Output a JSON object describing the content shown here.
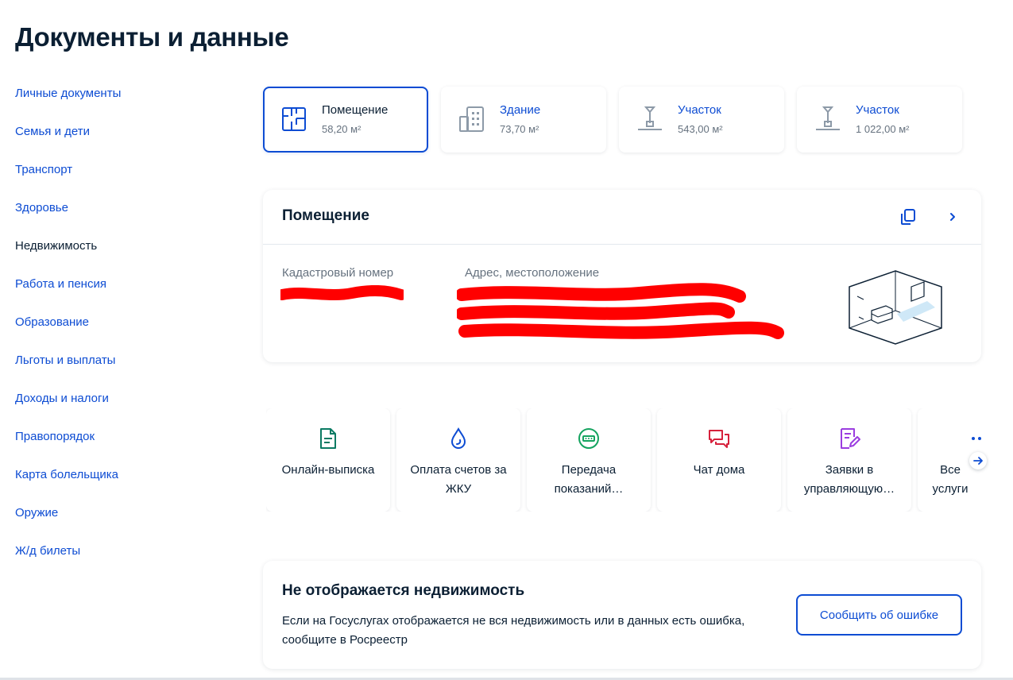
{
  "page_title": "Документы и данные",
  "sidebar": {
    "items": [
      {
        "label": "Личные документы"
      },
      {
        "label": "Семья и дети"
      },
      {
        "label": "Транспорт"
      },
      {
        "label": "Здоровье"
      },
      {
        "label": "Недвижимость",
        "active": true
      },
      {
        "label": "Работа и пенсия"
      },
      {
        "label": "Образование"
      },
      {
        "label": "Льготы и выплаты"
      },
      {
        "label": "Доходы и налоги"
      },
      {
        "label": "Правопорядок"
      },
      {
        "label": "Карта болельщика"
      },
      {
        "label": "Оружие"
      },
      {
        "label": "Ж/д билеты"
      }
    ]
  },
  "property_tiles": [
    {
      "name": "Помещение",
      "area": "58,20 м²",
      "icon": "room-plan-icon",
      "selected": true
    },
    {
      "name": "Здание",
      "area": "73,70 м²",
      "icon": "building-icon"
    },
    {
      "name": "Участок",
      "area": "543,00 м²",
      "icon": "land-plot-icon"
    },
    {
      "name": "Участок",
      "area": "1 022,00 м²",
      "icon": "land-plot-icon"
    }
  ],
  "detail_card": {
    "title": "Помещение",
    "cadastral_label": "Кадастровый номер",
    "address_label": "Адрес, местоположение",
    "copy_icon": "copy-icon",
    "open_icon": "chevron-right-icon"
  },
  "services": [
    {
      "label": "Онлайн-выписка",
      "icon": "document-icon",
      "color": "#0b7a63"
    },
    {
      "label": "Оплата счетов за ЖКУ",
      "icon": "water-drop-icon",
      "color": "#0d4cd3"
    },
    {
      "label": "Передача показаний…",
      "icon": "meter-icon",
      "color": "#14a35f"
    },
    {
      "label": "Чат дома",
      "icon": "chat-icon",
      "color": "#d6213c"
    },
    {
      "label": "Заявки в управляющую…",
      "icon": "request-edit-icon",
      "color": "#9b3de0"
    },
    {
      "label": "Все услуги",
      "icon": "more-dots-icon",
      "color": "#0d4cd3"
    }
  ],
  "notice": {
    "title": "Не отображается недвижимость",
    "text": "Если на Госуслугах отображается не вся недвижимость или в данных есть ошибка, сообщите в Росреестр",
    "button": "Сообщить об ошибке"
  },
  "colors": {
    "accent": "#0d4cd3",
    "text": "#0b1f33",
    "muted": "#66727f",
    "redaction": "#ff0000"
  }
}
